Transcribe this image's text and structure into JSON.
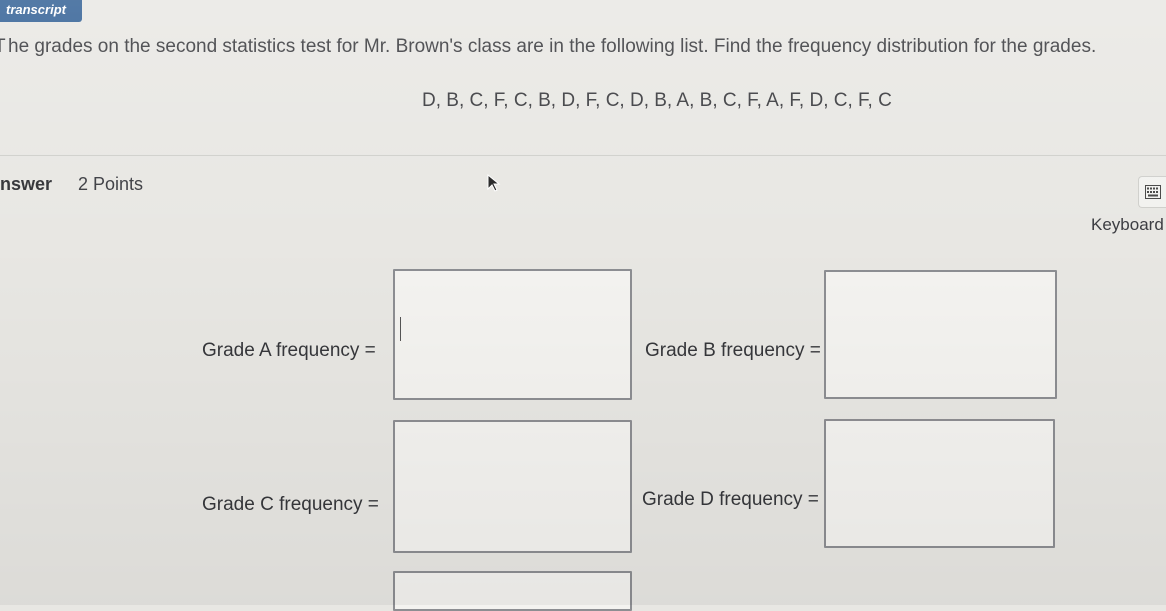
{
  "header": {
    "transcript_tab": "transcript"
  },
  "question": {
    "prompt": "he grades on the second statistics test for Mr. Brown's class are in the following list. Find the frequency distribution for the grades.",
    "prompt_first_letter_partial": "T",
    "grades": "D, B, C, F, C, B, D, F, C, D, B, A, B, C, F, A, F, D, C, F, C"
  },
  "answer": {
    "label": "nswer",
    "points": "2 Points",
    "keyboard_label": "Keyboard",
    "fields": [
      {
        "label": "Grade A frequency =",
        "value": ""
      },
      {
        "label": "Grade B frequency =",
        "value": ""
      },
      {
        "label": "Grade C frequency =",
        "value": ""
      },
      {
        "label": "Grade D frequency =",
        "value": ""
      }
    ]
  },
  "icons": {
    "cursor": "mouse-pointer-icon",
    "keyboard": "keyboard-icon"
  },
  "colors": {
    "transcript_tab_bg": "#2e5d93",
    "page_bg": "#e8e7e3",
    "box_border": "#8d8e92"
  }
}
